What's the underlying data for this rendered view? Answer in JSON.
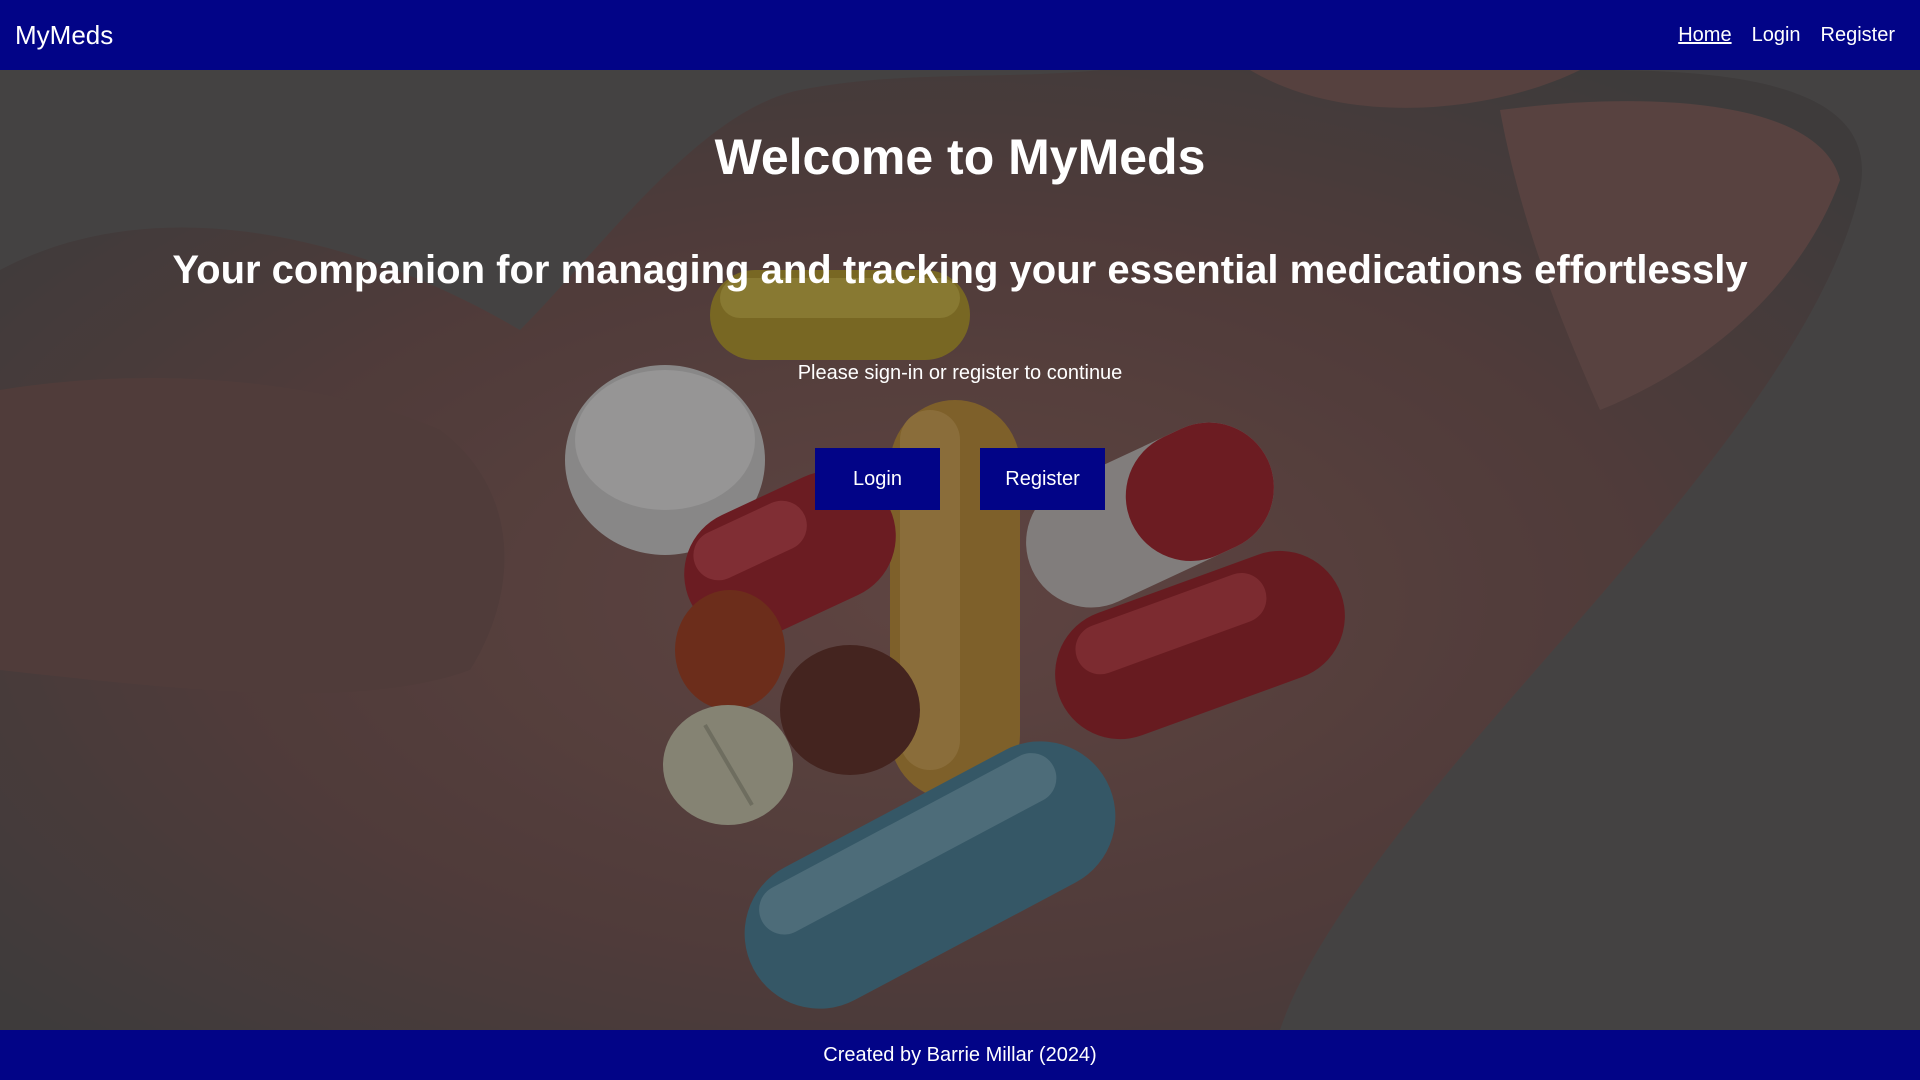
{
  "navbar": {
    "brand": "MyMeds",
    "links": [
      {
        "label": "Home",
        "active": true
      },
      {
        "label": "Login",
        "active": false
      },
      {
        "label": "Register",
        "active": false
      }
    ]
  },
  "hero": {
    "background_image": "hand holding assorted pills and capsules",
    "title": "Welcome to MyMeds",
    "subtitle": "Your companion for managing and tracking your essential medications effortlessly",
    "prompt": "Please sign-in or register to continue",
    "buttons": {
      "login": "Login",
      "register": "Register"
    }
  },
  "footer": {
    "text": "Created by Barrie Millar (2024)"
  },
  "colors": {
    "primary": "#020487",
    "text": "#ffffff",
    "overlay": "#3a3a3a"
  }
}
